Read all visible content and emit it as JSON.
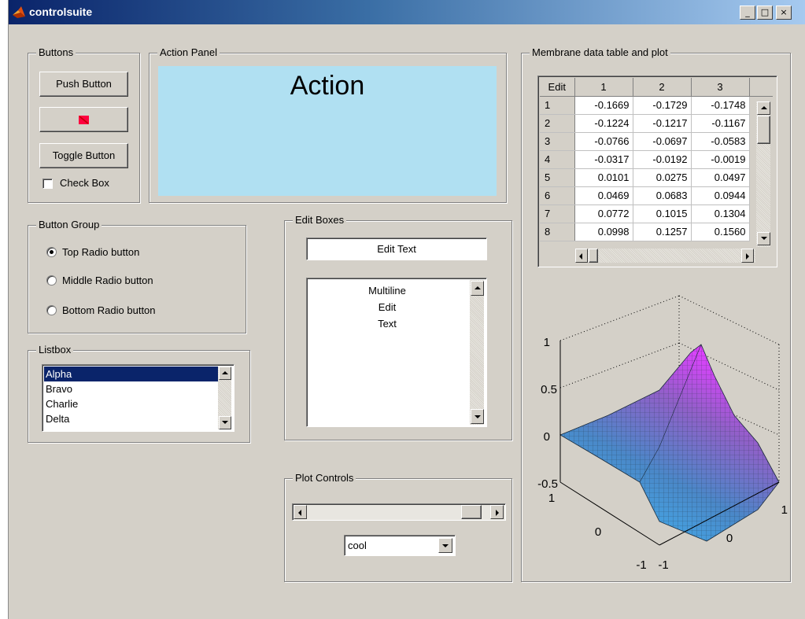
{
  "window": {
    "title": "controlsuite",
    "min_label": "_",
    "max_label": "□",
    "close_label": "×"
  },
  "buttons_panel": {
    "title": "Buttons",
    "push_label": "Push Button",
    "toggle_label": "Toggle Button",
    "checkbox_label": "Check Box",
    "checkbox_checked": false
  },
  "action_panel": {
    "title": "Action Panel",
    "text": "Action",
    "bg_color": "#b0e0f2"
  },
  "button_group": {
    "title": "Button Group",
    "options": [
      "Top Radio button",
      "Middle Radio button",
      "Bottom Radio button"
    ],
    "selected": "Top Radio button"
  },
  "listbox": {
    "title": "Listbox",
    "items": [
      "Alpha",
      "Bravo",
      "Charlie",
      "Delta"
    ],
    "selected": "Alpha"
  },
  "edit_boxes": {
    "title": "Edit Boxes",
    "single_value": "Edit Text",
    "multiline_lines": [
      "Multiline",
      "Edit",
      "Text"
    ]
  },
  "plot_controls": {
    "title": "Plot Controls",
    "slider_value": 0.92,
    "colormap_value": "cool"
  },
  "membrane": {
    "title": "Membrane data table and plot",
    "table": {
      "corner": "Edit",
      "columns": [
        "1",
        "2",
        "3"
      ],
      "rows": [
        {
          "label": "1",
          "values": [
            "-0.1669",
            "-0.1729",
            "-0.1748"
          ]
        },
        {
          "label": "2",
          "values": [
            "-0.1224",
            "-0.1217",
            "-0.1167"
          ]
        },
        {
          "label": "3",
          "values": [
            "-0.0766",
            "-0.0697",
            "-0.0583"
          ]
        },
        {
          "label": "4",
          "values": [
            "-0.0317",
            "-0.0192",
            "-0.0019"
          ]
        },
        {
          "label": "5",
          "values": [
            "0.0101",
            "0.0275",
            "0.0497"
          ]
        },
        {
          "label": "6",
          "values": [
            "0.0469",
            "0.0683",
            "0.0944"
          ]
        },
        {
          "label": "7",
          "values": [
            "0.0772",
            "0.1015",
            "0.1304"
          ]
        },
        {
          "label": "8",
          "values": [
            "0.0998",
            "0.1257",
            "0.1560"
          ]
        }
      ]
    },
    "plot": {
      "z_ticks": [
        "1",
        "0.5",
        "0",
        "-0.5"
      ],
      "x_ticks": [
        "1",
        "0",
        "-1"
      ],
      "y_ticks": [
        "-1",
        "0",
        "1"
      ],
      "colormap": "cool"
    }
  }
}
